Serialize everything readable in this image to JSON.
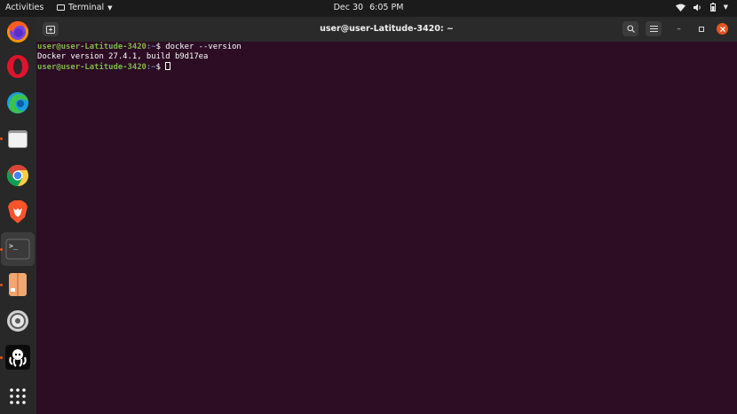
{
  "topbar": {
    "activities": "Activities",
    "app_menu": "Terminal",
    "date": "Dec 30",
    "time": "6:05 PM"
  },
  "dock": {
    "items": [
      {
        "name": "firefox",
        "running": false
      },
      {
        "name": "opera",
        "running": false
      },
      {
        "name": "edge",
        "running": false
      },
      {
        "name": "files",
        "running": true
      },
      {
        "name": "chrome",
        "running": false
      },
      {
        "name": "brave",
        "running": false
      },
      {
        "name": "terminal",
        "running": true,
        "active": true
      },
      {
        "name": "software",
        "running": true
      },
      {
        "name": "settings",
        "running": false
      },
      {
        "name": "gitkraken",
        "running": true
      },
      {
        "name": "show-applications",
        "running": false
      }
    ]
  },
  "window": {
    "title": "user@user-Latitude-3420: ~"
  },
  "terminal": {
    "line1": {
      "user": "user@user-Latitude-3420",
      "path": ":~",
      "symbol": "$ ",
      "command": "docker --version"
    },
    "line2": "Docker version 27.4.1, build b9d17ea",
    "line3": {
      "user": "user@user-Latitude-3420",
      "path": ":~",
      "symbol": "$ "
    }
  },
  "colors": {
    "terminal_bg": "#2c0d24",
    "prompt_user": "#7fb84a",
    "prompt_path": "#5f87af",
    "accent": "#e95420"
  }
}
